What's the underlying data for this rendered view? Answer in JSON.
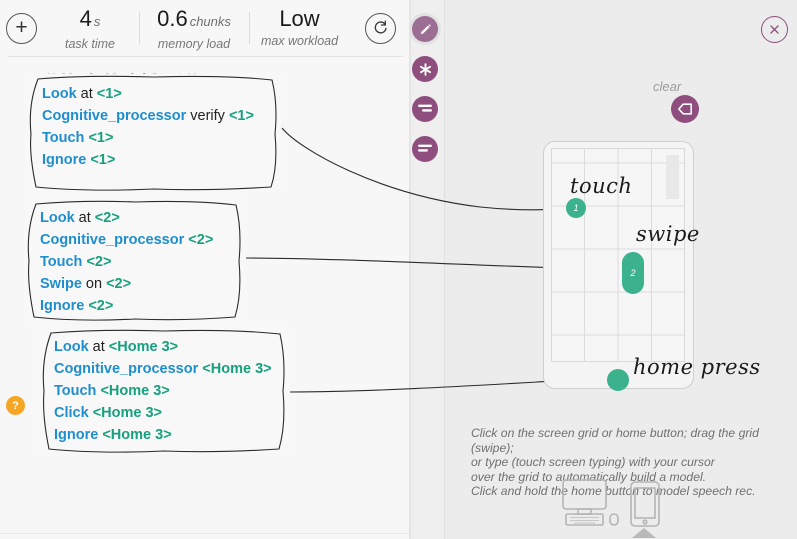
{
  "metrics": {
    "add_label": "+",
    "items": [
      {
        "name": "task-time",
        "value": "4",
        "unit": "s",
        "label": "task time"
      },
      {
        "name": "memory-load",
        "value": "0.6",
        "unit": "chunks",
        "label": "memory load"
      },
      {
        "name": "max-workload",
        "value": "Low",
        "unit": "",
        "label": "max workload"
      }
    ],
    "refresh_icon": "refresh-icon"
  },
  "help": {
    "label": "?"
  },
  "model": {
    "title": "** Magic Model Start **",
    "boxes": [
      {
        "name": "rule-box-1",
        "lines": [
          {
            "parts": [
              {
                "t": "Look",
                "c": "kw"
              },
              {
                "t": " at ",
                "c": "plain"
              },
              {
                "t": "<1>",
                "c": "obj"
              }
            ]
          },
          {
            "parts": [
              {
                "t": "Cognitive_processor",
                "c": "kw"
              },
              {
                "t": " verify ",
                "c": "plain"
              },
              {
                "t": "<1>",
                "c": "obj"
              }
            ]
          },
          {
            "parts": [
              {
                "t": "Touch",
                "c": "kw"
              },
              {
                "t": " ",
                "c": "plain"
              },
              {
                "t": "<1>",
                "c": "obj"
              }
            ]
          },
          {
            "parts": [
              {
                "t": "Ignore",
                "c": "kw"
              },
              {
                "t": " ",
                "c": "plain"
              },
              {
                "t": "<1>",
                "c": "obj"
              }
            ]
          }
        ]
      },
      {
        "name": "rule-box-2",
        "lines": [
          {
            "parts": [
              {
                "t": "Look",
                "c": "kw"
              },
              {
                "t": " at ",
                "c": "plain"
              },
              {
                "t": "<2>",
                "c": "obj"
              }
            ]
          },
          {
            "parts": [
              {
                "t": "Cognitive_processor",
                "c": "kw"
              },
              {
                "t": " ",
                "c": "plain"
              },
              {
                "t": "<2>",
                "c": "obj"
              }
            ]
          },
          {
            "parts": [
              {
                "t": "Touch",
                "c": "kw"
              },
              {
                "t": " ",
                "c": "plain"
              },
              {
                "t": "<2>",
                "c": "obj"
              }
            ]
          },
          {
            "parts": [
              {
                "t": "Swipe",
                "c": "kw"
              },
              {
                "t": " on ",
                "c": "plain"
              },
              {
                "t": "<2>",
                "c": "obj"
              }
            ]
          },
          {
            "parts": [
              {
                "t": "Ignore",
                "c": "kw"
              },
              {
                "t": " ",
                "c": "plain"
              },
              {
                "t": "<2>",
                "c": "obj"
              }
            ]
          }
        ]
      },
      {
        "name": "rule-box-3",
        "lines": [
          {
            "parts": [
              {
                "t": "Look",
                "c": "kw"
              },
              {
                "t": " at ",
                "c": "plain"
              },
              {
                "t": "<Home 3>",
                "c": "obj"
              }
            ]
          },
          {
            "parts": [
              {
                "t": "Cognitive_processor",
                "c": "kw"
              },
              {
                "t": " ",
                "c": "plain"
              },
              {
                "t": "<Home 3>",
                "c": "obj"
              }
            ]
          },
          {
            "parts": [
              {
                "t": "Touch",
                "c": "kw"
              },
              {
                "t": " ",
                "c": "plain"
              },
              {
                "t": "<Home 3>",
                "c": "obj"
              }
            ]
          },
          {
            "parts": [
              {
                "t": "Click",
                "c": "kw"
              },
              {
                "t": " ",
                "c": "plain"
              },
              {
                "t": "<Home 3>",
                "c": "obj"
              }
            ]
          },
          {
            "parts": [
              {
                "t": "Ignore",
                "c": "kw"
              },
              {
                "t": " ",
                "c": "plain"
              },
              {
                "t": "<Home 3>",
                "c": "obj"
              }
            ]
          }
        ]
      }
    ]
  },
  "toolbar": {
    "tools": [
      {
        "name": "pencil-icon",
        "label": "pencil",
        "selected": true
      },
      {
        "name": "asterisk-icon",
        "label": "asterisk",
        "selected": false
      },
      {
        "name": "align-right-icon",
        "label": "align right",
        "selected": false
      },
      {
        "name": "align-left-icon",
        "label": "align left",
        "selected": false
      }
    ]
  },
  "canvas": {
    "clear_label": "clear",
    "clear_icon": "backspace-icon",
    "close_icon": "close-icon",
    "annotations": [
      {
        "name": "annotation-touch",
        "text": "touch"
      },
      {
        "name": "annotation-swipe",
        "text": "swipe"
      },
      {
        "name": "annotation-home-press",
        "text": "home press"
      }
    ],
    "markers": [
      {
        "name": "marker-1",
        "label": "1",
        "shape": "circle"
      },
      {
        "name": "marker-2",
        "label": "2",
        "shape": "capsule"
      },
      {
        "name": "marker-3",
        "label": "",
        "shape": "circle"
      }
    ],
    "instructions": "Click on the screen grid or home button; drag the grid (swipe); or type (touch screen typing) with your cursor over the grid to automatically build a model. Click and hold the home button to model speech rec.",
    "instruction_lines": [
      "Click on the screen grid or home button; drag the grid (swipe);",
      "or type (touch screen typing) with your cursor",
      "over the grid to automatically build a model.",
      "Click and hold the home button to model speech rec."
    ],
    "devices": [
      {
        "name": "desktop-icon",
        "label": "desktop"
      },
      {
        "name": "smartphone-icon",
        "label": "smartphone"
      }
    ]
  },
  "colors": {
    "keyword": "#1f8ecd",
    "object": "#17a07e",
    "marker": "#3cb28c",
    "accent_purple": "#8e4f7f",
    "help_orange": "#f5a623"
  }
}
